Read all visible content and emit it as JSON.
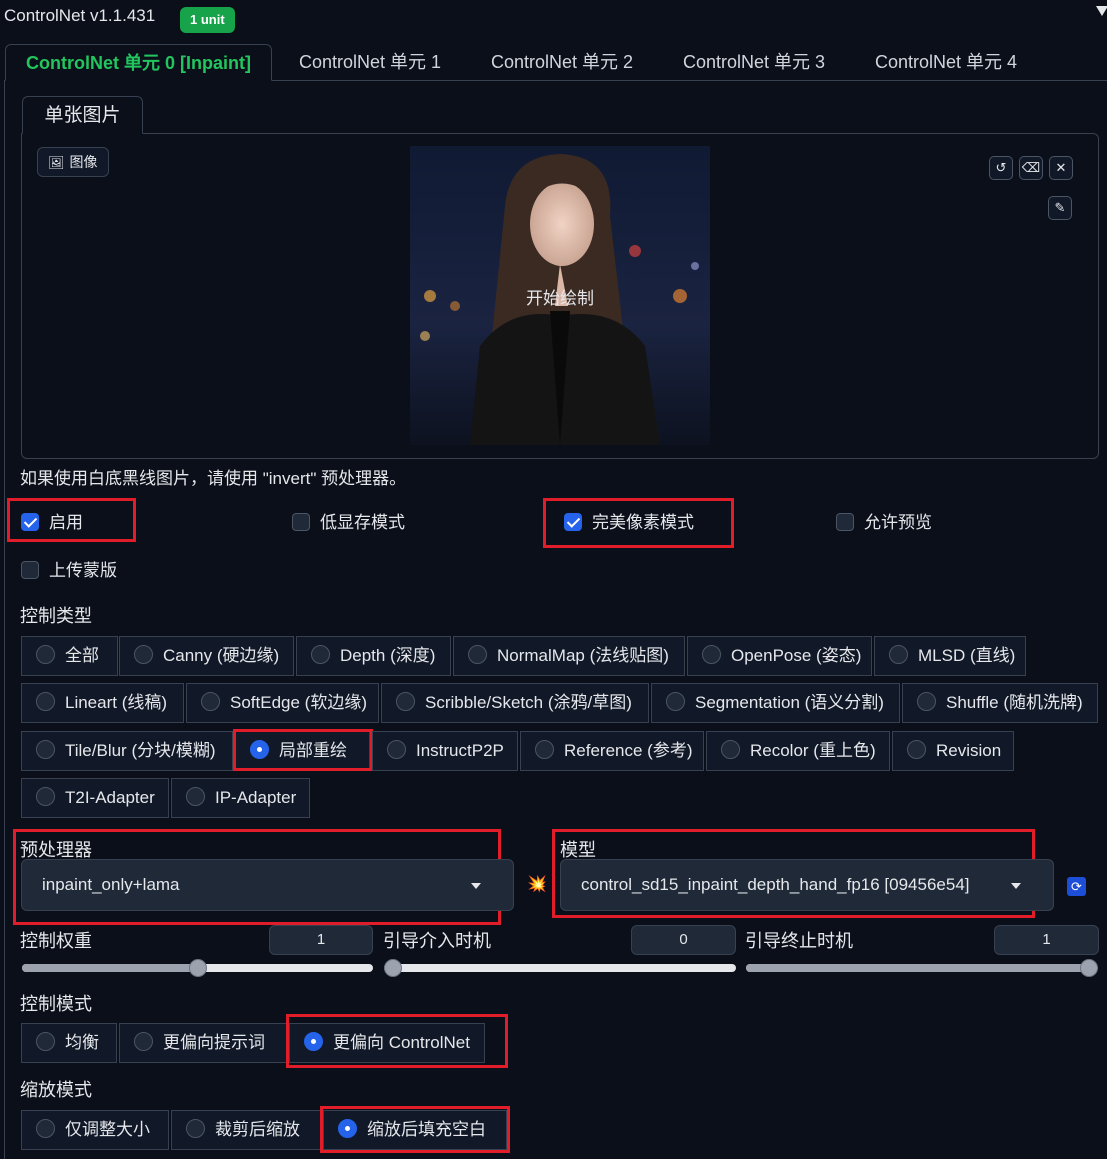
{
  "header": {
    "title": "ControlNet v1.1.431",
    "badge": "1 unit"
  },
  "unit_tabs": [
    {
      "label": "ControlNet 单元 0 [Inpaint]",
      "active": true
    },
    {
      "label": "ControlNet 单元 1",
      "active": false
    },
    {
      "label": "ControlNet 单元 2",
      "active": false
    },
    {
      "label": "ControlNet 单元 3",
      "active": false
    },
    {
      "label": "ControlNet 单元 4",
      "active": false
    }
  ],
  "input_tab": "单张图片",
  "image": {
    "label": "图像",
    "overlay_text": "开始绘制",
    "tools": {
      "undo": "↺",
      "eraser": "⌫",
      "close": "✕",
      "brush": "✎"
    }
  },
  "hint": "如果使用白底黑线图片，请使用 \"invert\" 预处理器。",
  "checkboxes": {
    "enable": {
      "label": "启用",
      "checked": true
    },
    "low_vram": {
      "label": "低显存模式",
      "checked": false
    },
    "pixel_perfect": {
      "label": "完美像素模式",
      "checked": true
    },
    "allow_preview": {
      "label": "允许预览",
      "checked": false
    },
    "upload_mask": {
      "label": "上传蒙版",
      "checked": false
    }
  },
  "control_type": {
    "label": "控制类型",
    "options": [
      "全部",
      "Canny (硬边缘)",
      "Depth (深度)",
      "NormalMap (法线贴图)",
      "OpenPose (姿态)",
      "MLSD (直线)",
      "Lineart (线稿)",
      "SoftEdge (软边缘)",
      "Scribble/Sketch (涂鸦/草图)",
      "Segmentation (语义分割)",
      "Shuffle (随机洗牌)",
      "Tile/Blur (分块/模糊)",
      "局部重绘",
      "InstructP2P",
      "Reference (参考)",
      "Recolor (重上色)",
      "Revision",
      "T2I-Adapter",
      "IP-Adapter"
    ],
    "selected": "局部重绘"
  },
  "preprocessor": {
    "label": "预处理器",
    "value": "inpaint_only+lama"
  },
  "model": {
    "label": "模型",
    "value": "control_sd15_inpaint_depth_hand_fp16 [09456e54]"
  },
  "icons": {
    "run": "💥",
    "refresh": "refresh-icon"
  },
  "sliders": {
    "weight": {
      "label": "控制权重",
      "value": "1",
      "fraction": 0.5
    },
    "start": {
      "label": "引导介入时机",
      "value": "0",
      "fraction": 0.0
    },
    "end": {
      "label": "引导终止时机",
      "value": "1",
      "fraction": 1.0
    }
  },
  "control_mode": {
    "label": "控制模式",
    "options": [
      "均衡",
      "更偏向提示词",
      "更偏向 ControlNet"
    ],
    "selected": "更偏向 ControlNet"
  },
  "resize_mode": {
    "label": "缩放模式",
    "options": [
      "仅调整大小",
      "裁剪后缩放",
      "缩放后填充空白"
    ],
    "selected": "缩放后填充空白"
  },
  "colors": {
    "accent_green": "#22c55e",
    "accent_blue": "#2563eb",
    "highlight_red": "#e11d2a"
  }
}
